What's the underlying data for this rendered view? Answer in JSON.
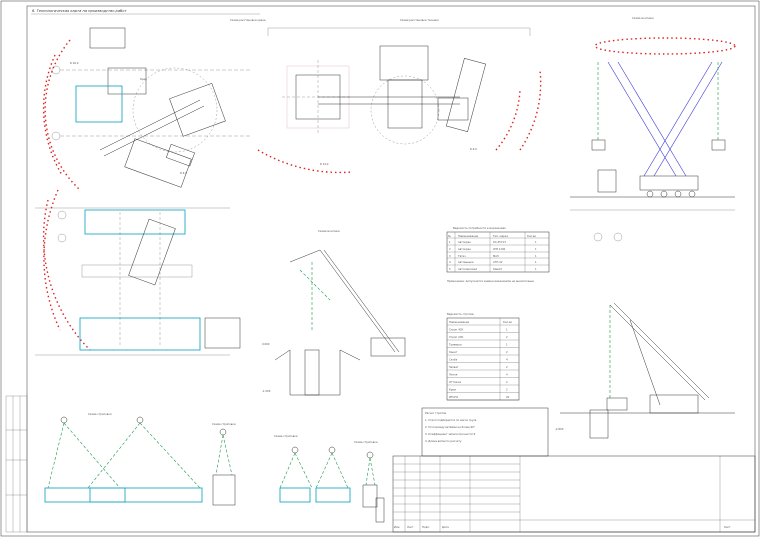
{
  "title": "6. Технологическая карта на производство работ",
  "views": {
    "plan_left": "Схема расстановки крана",
    "plan_center": "Схема расстановки техники",
    "elevation_right": "Схема монтажа",
    "section_mid": "Схема монтажа"
  },
  "table_equipment": {
    "heading": "Ведомость потребности в механизмах",
    "columns": [
      "№",
      "Наименование",
      "Тип, марка",
      "Кол-во"
    ],
    "rows": [
      [
        "1",
        "Автокран",
        "КС-55713",
        "1"
      ],
      [
        "2",
        "Автокран",
        "LTM 1100",
        "1"
      ],
      [
        "3",
        "Тягач",
        "МАЗ",
        "1"
      ],
      [
        "4",
        "Автовышка",
        "АГП-22",
        "1"
      ],
      [
        "5",
        "Автосамосвал",
        "КамАЗ",
        "1"
      ]
    ],
    "note": "Примечание: допускается замена механизмов на аналогичные"
  },
  "table_slings": {
    "heading": "Ведомость стропов",
    "columns": [
      "Наименование",
      "Кол-во"
    ],
    "rows": [
      [
        "Строп 4СК",
        "1"
      ],
      [
        "Строп 2СК",
        "2"
      ],
      [
        "Траверса",
        "1"
      ],
      [
        "Канат",
        "2"
      ],
      [
        "Скоба",
        "4"
      ],
      [
        "Захват",
        "2"
      ],
      [
        "Петля",
        "4"
      ],
      [
        "Оттяжка",
        "2"
      ],
      [
        "Крюк",
        "2"
      ],
      [
        "ИТОГО",
        "20"
      ]
    ]
  },
  "notes": {
    "heading": "Расчет стропов",
    "lines": [
      "1. Строп подбирается по массе груза",
      "2. Угол между ветвями не более 90°",
      "3. Коэффициент запаса прочности 6",
      "4. Длина ветви по расчету"
    ]
  },
  "sling_schemes": [
    "Схема строповки",
    "Схема строповки",
    "Схема строповки",
    "Схема строповки"
  ],
  "ground_marks": [
    "0.000",
    "-1.500",
    "-2.800"
  ],
  "stamp": {
    "rows": [
      "Изм.",
      "Лист",
      "Подп.",
      "Дата"
    ],
    "sheet_label": "Лист"
  }
}
